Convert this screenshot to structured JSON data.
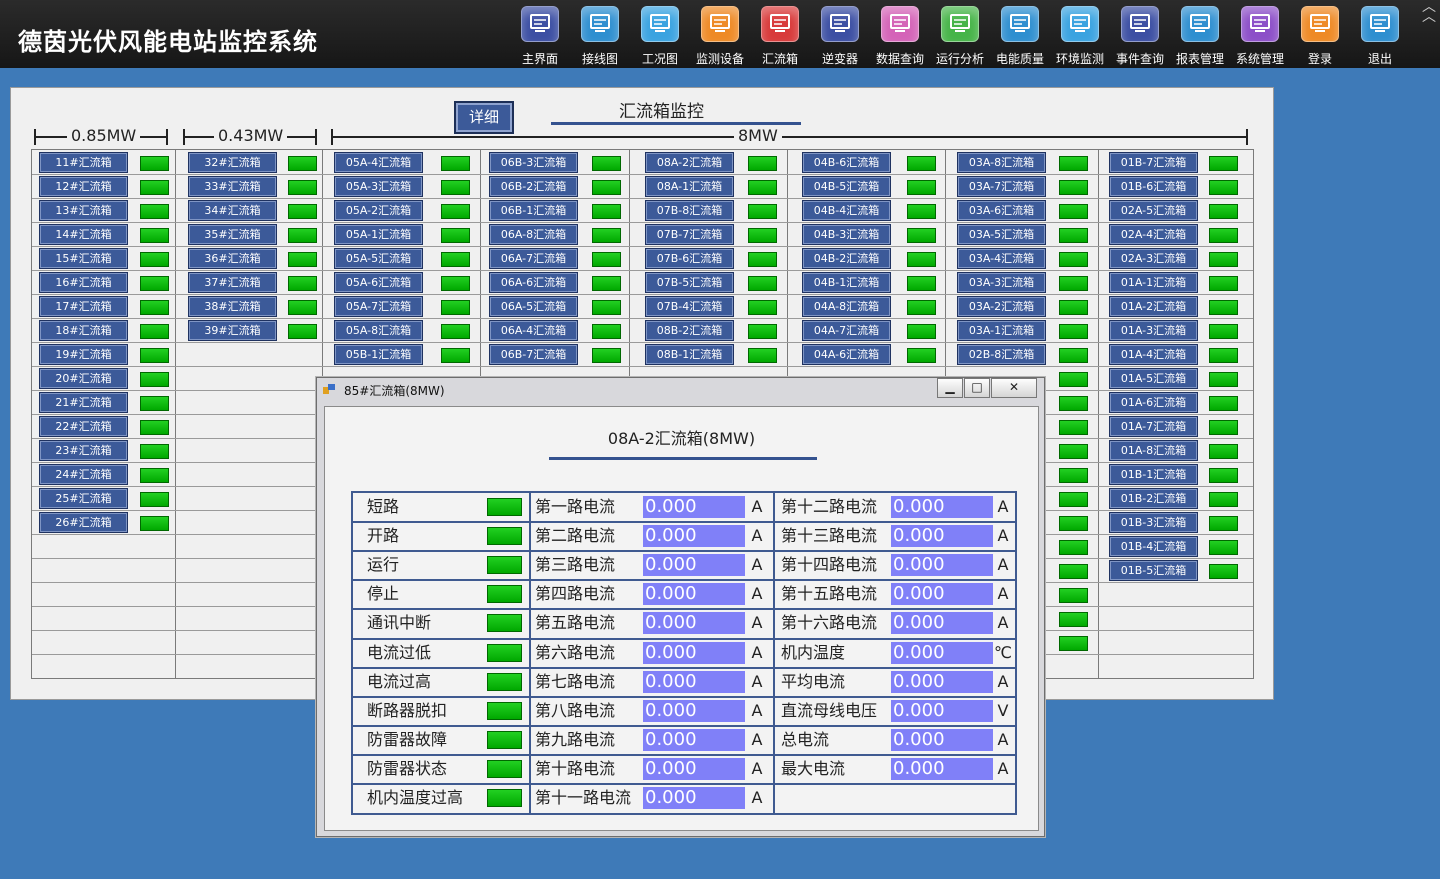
{
  "app_title": "德茵光伏风能电站监控系统",
  "nav": [
    {
      "label": "主界面",
      "icon": "monitor-icon",
      "color": "#3c4fa3"
    },
    {
      "label": "接线图",
      "icon": "wiring-diagram-icon",
      "color": "#2f8fd0"
    },
    {
      "label": "工况图",
      "icon": "status-chart-icon",
      "color": "#3aa3e0"
    },
    {
      "label": "监测设备",
      "icon": "monitoring-device-icon",
      "color": "#ee8a26"
    },
    {
      "label": "汇流箱",
      "icon": "combiner-box-icon",
      "color": "#d83a3a"
    },
    {
      "label": "逆变器",
      "icon": "inverter-icon",
      "color": "#3c4fa3"
    },
    {
      "label": "数据查询",
      "icon": "data-query-icon",
      "color": "#d464b8"
    },
    {
      "label": "运行分析",
      "icon": "run-analysis-icon",
      "color": "#46b448"
    },
    {
      "label": "电能质量",
      "icon": "power-quality-icon",
      "color": "#2f8fd0"
    },
    {
      "label": "环境监测",
      "icon": "environment-icon",
      "color": "#3aa3e0"
    },
    {
      "label": "事件查询",
      "icon": "event-query-icon",
      "color": "#3c4fa3"
    },
    {
      "label": "报表管理",
      "icon": "report-icon",
      "color": "#2f8fd0"
    },
    {
      "label": "系统管理",
      "icon": "system-settings-icon",
      "color": "#8c4fc8"
    },
    {
      "label": "登录",
      "icon": "login-icon",
      "color": "#ee8a26"
    },
    {
      "label": "退出",
      "icon": "logout-icon",
      "color": "#2f8fd0"
    }
  ],
  "panel": {
    "title": "汇流箱监控",
    "detail_label": "详细",
    "sections": [
      "0.85MW",
      "0.43MW",
      "8MW"
    ]
  },
  "columns": [
    [
      "11#汇流箱",
      "12#汇流箱",
      "13#汇流箱",
      "14#汇流箱",
      "15#汇流箱",
      "16#汇流箱",
      "17#汇流箱",
      "18#汇流箱",
      "19#汇流箱",
      "20#汇流箱",
      "21#汇流箱",
      "22#汇流箱",
      "23#汇流箱",
      "24#汇流箱",
      "25#汇流箱",
      "26#汇流箱"
    ],
    [
      "32#汇流箱",
      "33#汇流箱",
      "34#汇流箱",
      "35#汇流箱",
      "36#汇流箱",
      "37#汇流箱",
      "38#汇流箱",
      "39#汇流箱"
    ],
    [
      "05A-4汇流箱",
      "05A-3汇流箱",
      "05A-2汇流箱",
      "05A-1汇流箱",
      "05A-5汇流箱",
      "05A-6汇流箱",
      "05A-7汇流箱",
      "05A-8汇流箱",
      "05B-1汇流箱"
    ],
    [
      "06B-3汇流箱",
      "06B-2汇流箱",
      "06B-1汇流箱",
      "06A-8汇流箱",
      "06A-7汇流箱",
      "06A-6汇流箱",
      "06A-5汇流箱",
      "06A-4汇流箱",
      "06B-7汇流箱"
    ],
    [
      "08A-2汇流箱",
      "08A-1汇流箱",
      "07B-8汇流箱",
      "07B-7汇流箱",
      "07B-6汇流箱",
      "07B-5汇流箱",
      "07B-4汇流箱",
      "08B-2汇流箱",
      "08B-1汇流箱"
    ],
    [
      "04B-6汇流箱",
      "04B-5汇流箱",
      "04B-4汇流箱",
      "04B-3汇流箱",
      "04B-2汇流箱",
      "04B-1汇流箱",
      "04A-8汇流箱",
      "04A-7汇流箱",
      "04A-6汇流箱"
    ],
    [
      "03A-8汇流箱",
      "03A-7汇流箱",
      "03A-6汇流箱",
      "03A-5汇流箱",
      "03A-4汇流箱",
      "03A-3汇流箱",
      "03A-2汇流箱",
      "03A-1汇流箱",
      "02B-8汇流箱"
    ],
    [
      "01B-7汇流箱",
      "01B-6汇流箱",
      "02A-5汇流箱",
      "02A-4汇流箱",
      "02A-3汇流箱",
      "01A-1汇流箱",
      "01A-2汇流箱",
      "01A-3汇流箱",
      "01A-4汇流箱",
      "01A-5汇流箱",
      "01A-6汇流箱",
      "01A-7汇流箱",
      "01A-8汇流箱",
      "01B-1汇流箱",
      "01B-2汇流箱",
      "01B-3汇流箱",
      "01B-4汇流箱",
      "01B-5汇流箱"
    ]
  ],
  "popup": {
    "window_title": "85#汇流箱(8MW)",
    "heading": "08A-2汇流箱(8MW)",
    "minimize": "▁",
    "maximize": "□",
    "close": "✕",
    "status_items": [
      "短路",
      "开路",
      "运行",
      "停止",
      "通讯中断",
      "电流过低",
      "电流过高",
      "断路器脱扣",
      "防雷器故障",
      "防雷器状态",
      "机内温度过高"
    ],
    "mid_rows": [
      {
        "label": "第一路电流",
        "value": "0.000",
        "unit": "A"
      },
      {
        "label": "第二路电流",
        "value": "0.000",
        "unit": "A"
      },
      {
        "label": "第三路电流",
        "value": "0.000",
        "unit": "A"
      },
      {
        "label": "第四路电流",
        "value": "0.000",
        "unit": "A"
      },
      {
        "label": "第五路电流",
        "value": "0.000",
        "unit": "A"
      },
      {
        "label": "第六路电流",
        "value": "0.000",
        "unit": "A"
      },
      {
        "label": "第七路电流",
        "value": "0.000",
        "unit": "A"
      },
      {
        "label": "第八路电流",
        "value": "0.000",
        "unit": "A"
      },
      {
        "label": "第九路电流",
        "value": "0.000",
        "unit": "A"
      },
      {
        "label": "第十路电流",
        "value": "0.000",
        "unit": "A"
      },
      {
        "label": "第十一路电流",
        "value": "0.000",
        "unit": "A"
      }
    ],
    "right_rows": [
      {
        "label": "第十二路电流",
        "value": "0.000",
        "unit": "A"
      },
      {
        "label": "第十三路电流",
        "value": "0.000",
        "unit": "A"
      },
      {
        "label": "第十四路电流",
        "value": "0.000",
        "unit": "A"
      },
      {
        "label": "第十五路电流",
        "value": "0.000",
        "unit": "A"
      },
      {
        "label": "第十六路电流",
        "value": "0.000",
        "unit": "A"
      },
      {
        "label": "机内温度",
        "value": "0.000",
        "unit": "℃"
      },
      {
        "label": "平均电流",
        "value": "0.000",
        "unit": "A"
      },
      {
        "label": "直流母线电压",
        "value": "0.000",
        "unit": "V"
      },
      {
        "label": "总电流",
        "value": "0.000",
        "unit": "A"
      },
      {
        "label": "最大电流",
        "value": "0.000",
        "unit": "A"
      }
    ]
  }
}
